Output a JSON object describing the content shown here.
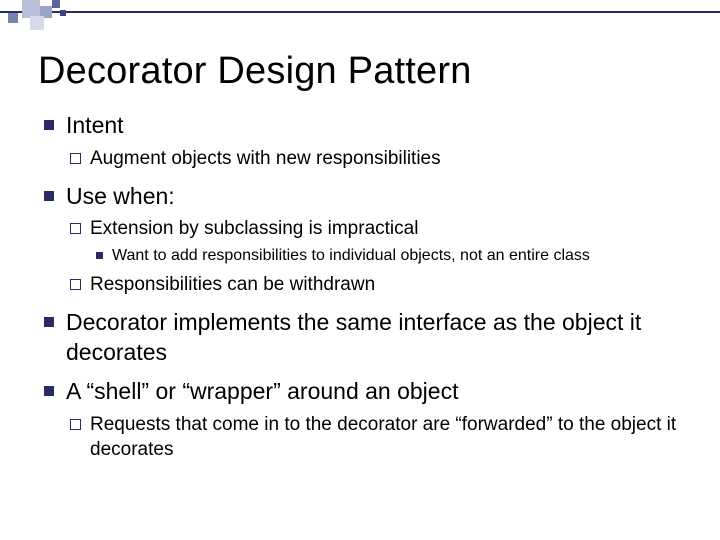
{
  "title": "Decorator Design Pattern",
  "b1": {
    "t": "Intent",
    "s1": "Augment objects with new responsibilities"
  },
  "b2": {
    "t": "Use when:",
    "s1": "Extension by subclassing is impractical",
    "s1a": "Want to add responsibilities to individual objects, not an entire class",
    "s2": "Responsibilities can be withdrawn"
  },
  "b3": {
    "t": "Decorator implements the same interface as the object it decorates"
  },
  "b4": {
    "t": "A “shell” or “wrapper” around an object",
    "s1": "Requests that come in to the decorator are “forwarded” to the object it decorates"
  }
}
